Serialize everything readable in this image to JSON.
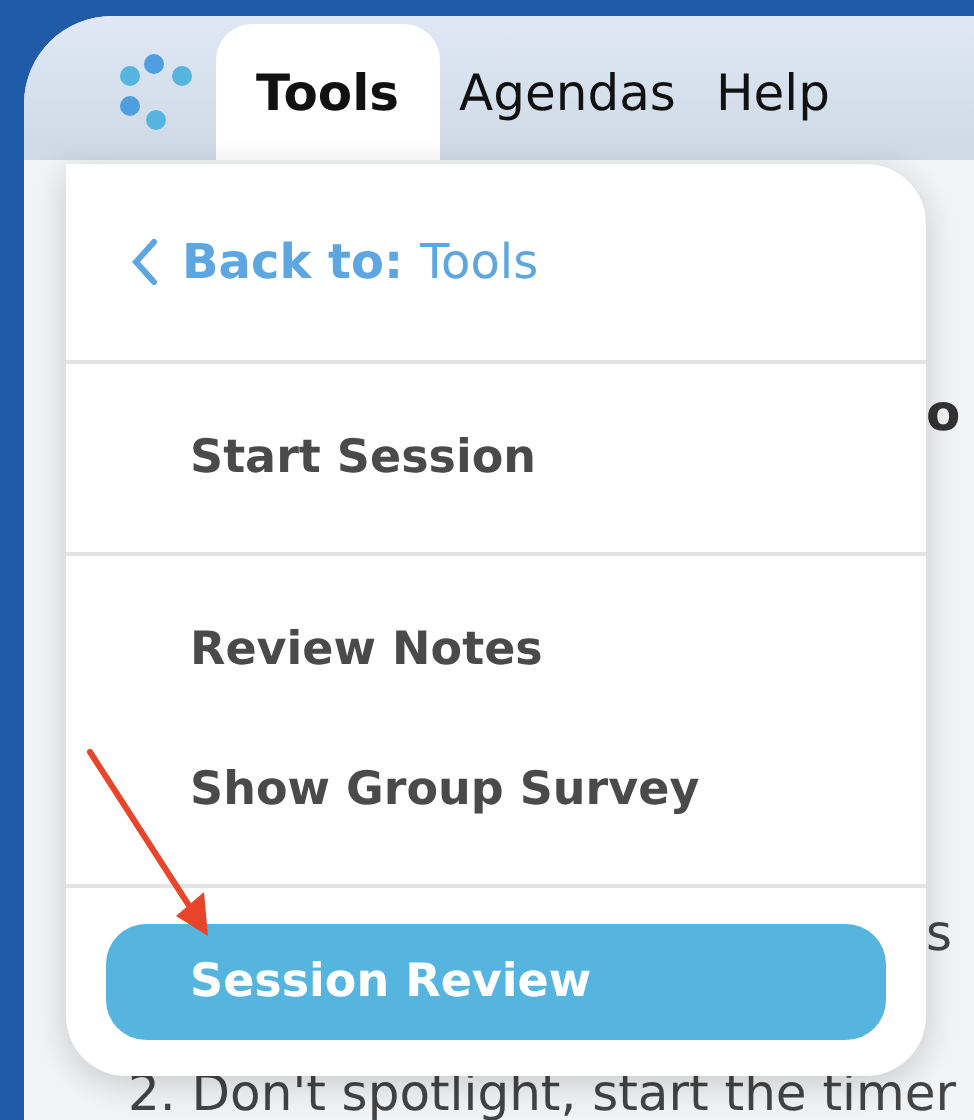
{
  "tabs": [
    {
      "label": "Tools",
      "selected": true
    },
    {
      "label": "Agendas",
      "selected": false
    },
    {
      "label": "Help",
      "selected": false
    }
  ],
  "menu": {
    "back": {
      "prefix": "Back to:",
      "target": "Tools"
    },
    "sections": [
      [
        {
          "label": "Start Session",
          "selected": false
        }
      ],
      [
        {
          "label": "Review Notes",
          "selected": false
        },
        {
          "label": "Show Group Survey",
          "selected": false
        }
      ],
      [
        {
          "label": "Session Review",
          "selected": true
        }
      ]
    ]
  },
  "background_text": {
    "heading_fragment": "o",
    "line_fragment": "s",
    "list_item": "2. Don't spotlight, start the timer"
  }
}
